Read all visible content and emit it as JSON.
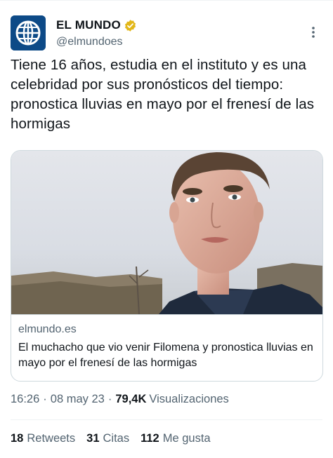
{
  "author": {
    "display_name": "EL MUNDO",
    "handle": "@elmundoes",
    "avatar_icon": "el-mundo-globe-logo",
    "verified_icon": "gold-verified-badge-icon",
    "avatar_color": "#0d4a87",
    "verified_color": "#e2b719"
  },
  "tweet": {
    "text": "Tiene 16 años, estudia en el instituto y es una celebridad por sus pronósticos del tiempo: pronostica lluvias en mayo por el frenesí de las hormigas"
  },
  "card": {
    "domain": "elmundo.es",
    "title": "El muchacho que vio venir Filomena y pronostica lluvias en mayo por el frenesí de las hormigas",
    "image_icon": "article-photo-young-man"
  },
  "meta": {
    "time": "16:26",
    "separator": "·",
    "date": "08 may 23",
    "views_count": "79,4K",
    "views_label": "Visualizaciones"
  },
  "stats": [
    {
      "count": "18",
      "label": "Retweets"
    },
    {
      "count": "31",
      "label": "Citas"
    },
    {
      "count": "112",
      "label": "Me gusta"
    }
  ],
  "more_icon": "more-options-vertical-icon"
}
